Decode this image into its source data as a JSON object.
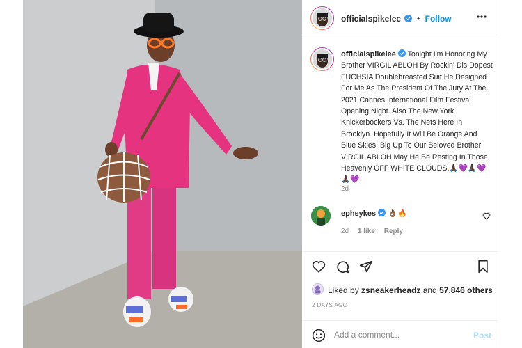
{
  "header": {
    "username": "officialspikelee",
    "dot": "•",
    "follow_label": "Follow",
    "more_icon": "ellipsis-icon"
  },
  "caption": {
    "username": "officialspikelee",
    "text": "Tonight I'm Honoring My Brother VIRGIL ABLOH By Rockin' Dis Dopest FUCHSIA Doublebreasted Suit He Designed For Me As The President Of The Jury At The 2021 Cannes International Film Festival Opening Night. Also The New York Knickerbockers Vs. The Nets Here In Brooklyn. Hopefully It Will Be Orange And Blue Skies. Big Up To Our Beloved Brother VIRGIL ABLOH.May He Be Resting In Those Heavenly OFF WHITE CLOUDS.",
    "emojis": "🙏🏿💜🙏🏿💜🙏🏿💜",
    "age": "2d"
  },
  "comment": {
    "username": "ephsykes",
    "emojis": "👌🏾🔥",
    "age": "2d",
    "likes": "1 like",
    "reply_label": "Reply"
  },
  "likes": {
    "prefix": "Liked by ",
    "user": "zsneakerheadz",
    "middle": " and ",
    "count": "57,846 others"
  },
  "timestamp": "2 DAYS AGO",
  "comment_bar": {
    "placeholder": "Add a comment...",
    "post_label": "Post"
  },
  "colors": {
    "accent": "#0095f6",
    "suit": "#e6337f",
    "background_wall": "#c8c9cb"
  }
}
